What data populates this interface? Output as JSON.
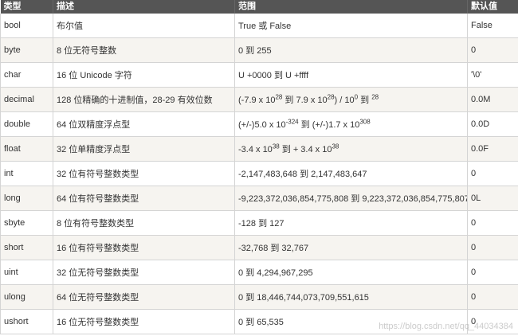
{
  "table": {
    "headers": [
      "类型",
      "描述",
      "范围",
      "默认值"
    ],
    "rows": [
      {
        "type": "bool",
        "desc": "布尔值",
        "range": [
          {
            "t": "True 或 False"
          }
        ],
        "default": "False"
      },
      {
        "type": "byte",
        "desc": "8 位无符号整数",
        "range": [
          {
            "t": "0 到 255"
          }
        ],
        "default": "0"
      },
      {
        "type": "char",
        "desc": "16 位 Unicode 字符",
        "range": [
          {
            "t": "U +0000 到 U +ffff"
          }
        ],
        "default": "'\\0'"
      },
      {
        "type": "decimal",
        "desc": "128 位精确的十进制值，28-29 有效位数",
        "range": [
          {
            "t": "(-7.9 x 10"
          },
          {
            "s": "28"
          },
          {
            "t": " 到 7.9 x 10"
          },
          {
            "s": "28"
          },
          {
            "t": ") / 10"
          },
          {
            "s": "0"
          },
          {
            "t": " 到 "
          },
          {
            "s": "28"
          }
        ],
        "default": "0.0M"
      },
      {
        "type": "double",
        "desc": "64 位双精度浮点型",
        "range": [
          {
            "t": "(+/-)5.0 x 10"
          },
          {
            "s": "-324"
          },
          {
            "t": " 到 (+/-)1.7 x 10"
          },
          {
            "s": "308"
          }
        ],
        "default": "0.0D"
      },
      {
        "type": "float",
        "desc": "32 位单精度浮点型",
        "range": [
          {
            "t": "-3.4 x 10"
          },
          {
            "s": "38"
          },
          {
            "t": " 到 + 3.4 x 10"
          },
          {
            "s": "38"
          }
        ],
        "default": "0.0F"
      },
      {
        "type": "int",
        "desc": "32 位有符号整数类型",
        "range": [
          {
            "t": "-2,147,483,648 到 2,147,483,647"
          }
        ],
        "default": "0"
      },
      {
        "type": "long",
        "desc": "64 位有符号整数类型",
        "range": [
          {
            "t": "-9,223,372,036,854,775,808 到 9,223,372,036,854,775,807"
          }
        ],
        "default": "0L"
      },
      {
        "type": "sbyte",
        "desc": "8 位有符号整数类型",
        "range": [
          {
            "t": "-128 到 127"
          }
        ],
        "default": "0"
      },
      {
        "type": "short",
        "desc": "16 位有符号整数类型",
        "range": [
          {
            "t": "-32,768 到 32,767"
          }
        ],
        "default": "0"
      },
      {
        "type": "uint",
        "desc": "32 位无符号整数类型",
        "range": [
          {
            "t": "0 到 4,294,967,295"
          }
        ],
        "default": "0"
      },
      {
        "type": "ulong",
        "desc": "64 位无符号整数类型",
        "range": [
          {
            "t": "0 到 18,446,744,073,709,551,615"
          }
        ],
        "default": "0"
      },
      {
        "type": "ushort",
        "desc": "16 位无符号整数类型",
        "range": [
          {
            "t": "0 到 65,535"
          }
        ],
        "default": "0"
      }
    ]
  },
  "watermark": "https://blog.csdn.net/qq_44034384"
}
